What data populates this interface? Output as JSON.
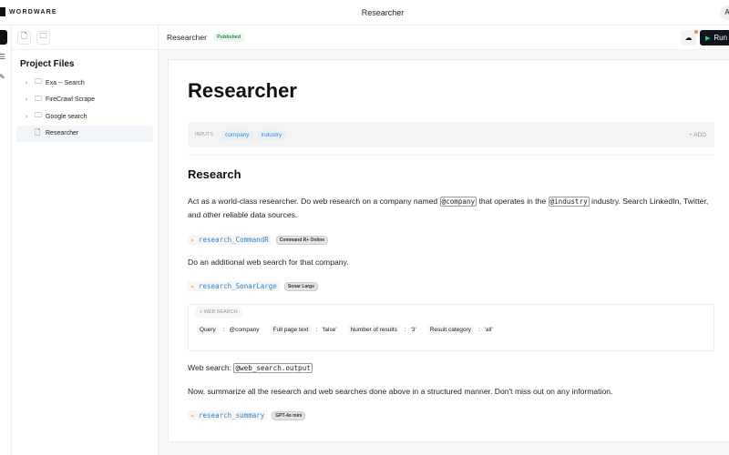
{
  "app": {
    "logo": "WORDWARE",
    "title": "Researcher",
    "avatar": "A"
  },
  "sidebar": {
    "title": "Project Files",
    "items": [
      {
        "label": "Exa -- Search",
        "type": "folder"
      },
      {
        "label": "FireCrawl Scrape",
        "type": "folder"
      },
      {
        "label": "Google search",
        "type": "folder"
      },
      {
        "label": "Researcher",
        "type": "file"
      }
    ]
  },
  "header": {
    "title": "Researcher",
    "status": "Published",
    "run_label": "Run"
  },
  "doc": {
    "title": "Researcher",
    "inputs_label": "INPUTS",
    "inputs": [
      "company",
      "industry"
    ],
    "add_label": "ADD",
    "section": "Research",
    "p1a": "Act as a world-class researcher. Do web research on a company named ",
    "p1_var1": "@company",
    "p1b": " that operates in the ",
    "p1_var2": "@industry",
    "p1c": " industry. Search LinkedIn, Twitter, and other reliable data sources.",
    "gen1": {
      "name": "research_CommandR",
      "model": "Command R+ Online"
    },
    "p2": "Do an additional web search for that company.",
    "gen2": {
      "name": "research_SonarLarge",
      "model": "Sonar Large"
    },
    "websearch": {
      "label": "WEB SEARCH",
      "params": [
        {
          "key": "Query",
          "value": "@company"
        },
        {
          "key": "Full page text",
          "value": "'false'"
        },
        {
          "key": "Number of results",
          "value": "'3'"
        },
        {
          "key": "Result category",
          "value": "'all'"
        }
      ]
    },
    "p3a": "Web search: ",
    "p3_var": "@web_search.output",
    "p4": "Now, summarize all the research and web searches done above in a structured manner. Don't miss out on any information.",
    "gen3": {
      "name": "research_summary",
      "model": "GPT-4o mini"
    }
  }
}
